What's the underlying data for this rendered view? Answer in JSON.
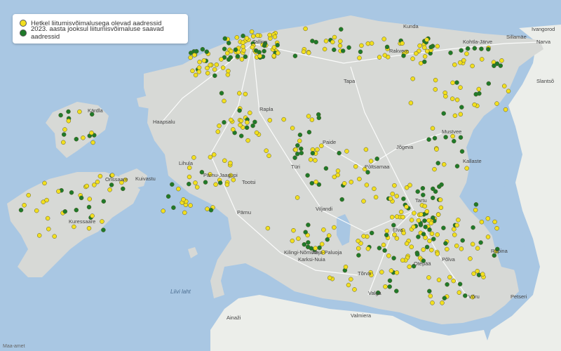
{
  "legend": {
    "items": [
      {
        "label": "Hetkel liitumisvõimalusega olevad aadressid",
        "color": "#f2df1f"
      },
      {
        "label": "2023. aasta jooksul liitumisvõimaluse saavad aadressid",
        "color": "#1f7a2a"
      }
    ]
  },
  "credit": "Maa-amet",
  "colors": {
    "sea": "#a9c7e3",
    "land": "#d7d9d6",
    "neighbor": "#eceeea",
    "road": "#ffffff"
  },
  "places": [
    {
      "name": "Tallinn"
    },
    {
      "name": "Kunda"
    },
    {
      "name": "Narva"
    },
    {
      "name": "Sillamäe"
    },
    {
      "name": "Kohtla-Järve"
    },
    {
      "name": "Rakvere"
    },
    {
      "name": "Tapa"
    },
    {
      "name": "Paide"
    },
    {
      "name": "Rapla"
    },
    {
      "name": "Haapsalu"
    },
    {
      "name": "Kärdla"
    },
    {
      "name": "Lihula"
    },
    {
      "name": "Pärnu-Jaagupi"
    },
    {
      "name": "Pärnu"
    },
    {
      "name": "Tootsi"
    },
    {
      "name": "Viljandi"
    },
    {
      "name": "Türi"
    },
    {
      "name": "Põltsamaa"
    },
    {
      "name": "Jõgeva"
    },
    {
      "name": "Mustvee"
    },
    {
      "name": "Kallaste"
    },
    {
      "name": "Tartu"
    },
    {
      "name": "Elva"
    },
    {
      "name": "Otepää"
    },
    {
      "name": "Valga"
    },
    {
      "name": "Võru"
    },
    {
      "name": "Põlva"
    },
    {
      "name": "Räpina"
    },
    {
      "name": "Kilingi-Nõmme"
    },
    {
      "name": "Karksi-Nuia"
    },
    {
      "name": "Tõrva"
    },
    {
      "name": "Abja-Paluoja"
    },
    {
      "name": "Kuressaare"
    },
    {
      "name": "Orissaare"
    },
    {
      "name": "Kuivastu"
    },
    {
      "name": "Ivangorod"
    },
    {
      "name": "Slantsõ"
    },
    {
      "name": "Liivi laht"
    },
    {
      "name": "Ainaži"
    },
    {
      "name": "Valmiera"
    },
    {
      "name": "Petseri"
    }
  ]
}
